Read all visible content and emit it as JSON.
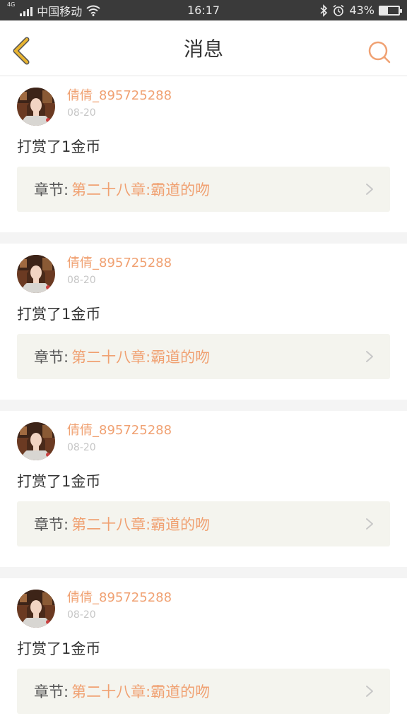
{
  "status_bar": {
    "network_type": "4G",
    "carrier": "中国移动",
    "time": "16:17",
    "battery_percent": "43%",
    "battery_level": 0.43
  },
  "header": {
    "title": "消息",
    "back_icon": "chevron-left-icon",
    "search_icon": "search-icon"
  },
  "messages": [
    {
      "username": "倩倩_895725288",
      "date": "08-20",
      "text": "打赏了1金币",
      "chapter_label": "章节:",
      "chapter_title": "第二十八章:霸道的吻"
    },
    {
      "username": "倩倩_895725288",
      "date": "08-20",
      "text": "打赏了1金币",
      "chapter_label": "章节:",
      "chapter_title": "第二十八章:霸道的吻"
    },
    {
      "username": "倩倩_895725288",
      "date": "08-20",
      "text": "打赏了1金币",
      "chapter_label": "章节:",
      "chapter_title": "第二十八章:霸道的吻"
    },
    {
      "username": "倩倩_895725288",
      "date": "08-20",
      "text": "打赏了1金币",
      "chapter_label": "章节:",
      "chapter_title": "第二十八章:霸道的吻"
    }
  ],
  "colors": {
    "accent": "#f0a172",
    "back_icon": "#e8b430",
    "status_bar_bg": "#3a3a3a"
  }
}
